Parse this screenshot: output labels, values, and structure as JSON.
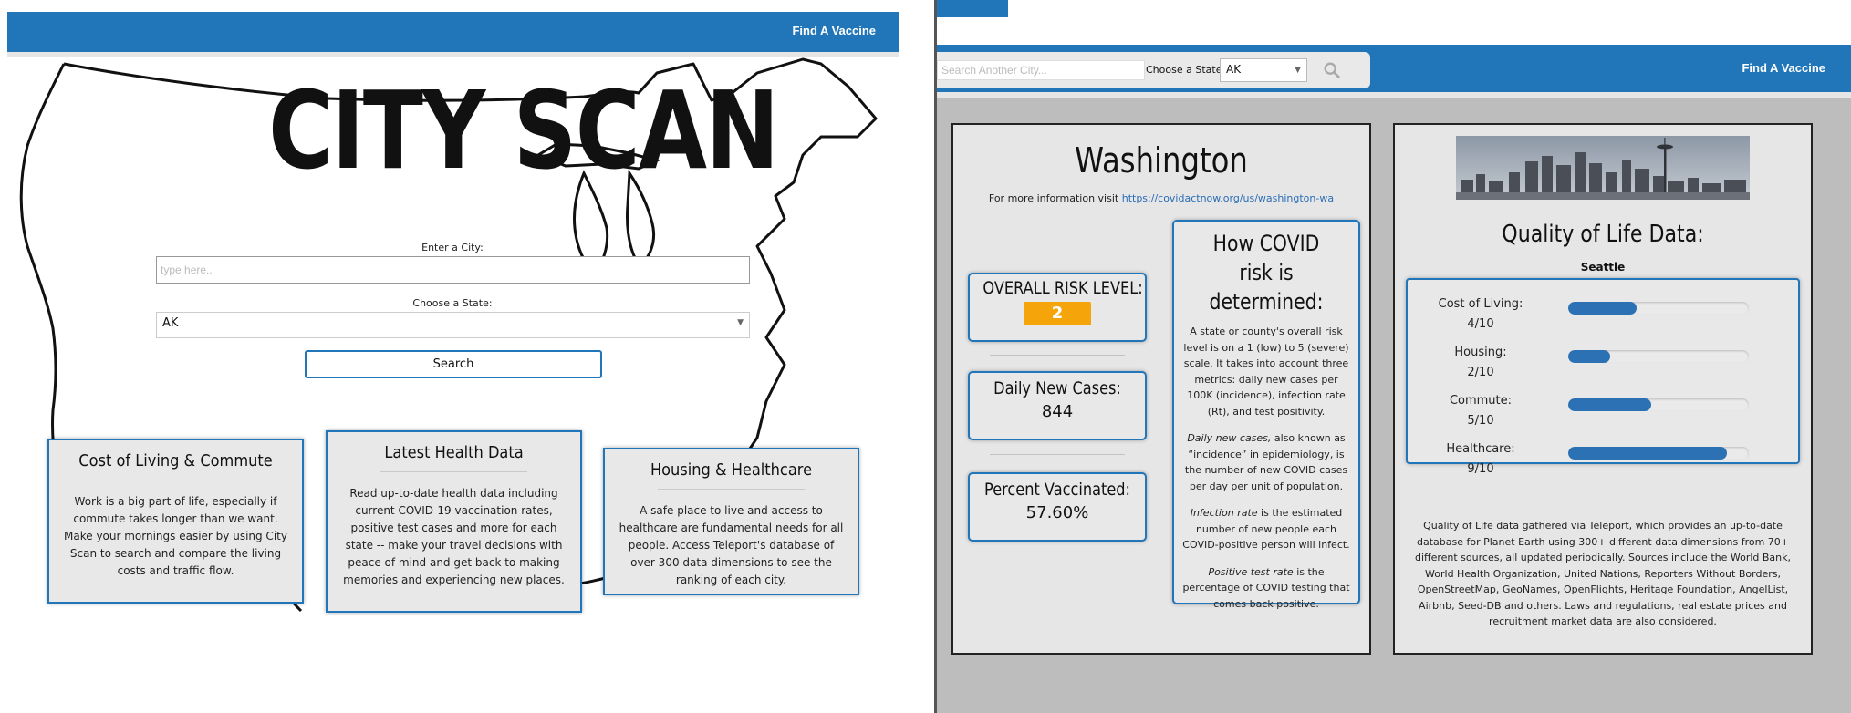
{
  "colors": {
    "brand_blue": "#2176ba",
    "risk_orange": "#f5a40a",
    "link_blue": "#2a6db6"
  },
  "landing": {
    "nav": {
      "find_vaccine": "Find A Vaccine"
    },
    "hero_title": "CITY SCAN",
    "city_label": "Enter a City:",
    "city_placeholder": "type here..",
    "state_label": "Choose a State:",
    "state_value": "AK",
    "search_button": "Search",
    "cards": [
      {
        "title": "Cost of Living & Commute",
        "body": "Work is a big part of life, especially if commute takes longer than we want. Make your mornings easier by using City Scan to search and compare the living costs and traffic flow."
      },
      {
        "title": "Latest Health Data",
        "body": "Read up-to-date health data including current COVID-19 vaccination rates, positive test cases and more for each state -- make your travel decisions with peace of mind and get back to making memories and experiencing new places."
      },
      {
        "title": "Housing & Healthcare",
        "body": "A safe place to live and access to healthcare are fundamental needs for all people. Access Teleport's database of over 300 data dimensions to see the ranking of each city."
      }
    ]
  },
  "results": {
    "nav": {
      "city_placeholder": "Search Another City...",
      "state_label": "Choose a State:",
      "state_value": "AK",
      "find_vaccine": "Find A Vaccine"
    },
    "state_name": "Washington",
    "more_info_prefix": "For more information visit",
    "more_info_link": "https://covidactnow.org/us/washington-wa",
    "risk": {
      "title": "OVERALL RISK LEVEL:",
      "value": "2"
    },
    "daily_cases": {
      "title": "Daily New Cases:",
      "value": "844"
    },
    "vaccinated": {
      "title": "Percent Vaccinated:",
      "value": "57.60%"
    },
    "covid_info": {
      "title": "How COVID risk is determined:",
      "p1": "A state or county's overall risk level is on a 1 (low) to 5 (severe) scale. It takes into account three metrics: daily new cases per 100K (incidence), infection rate (Rt), and test positivity.",
      "p2_em": "Daily new cases,",
      "p2": " also known as “incidence” in epidemiology, is the number of new COVID cases per day per unit of population.",
      "p3_em": "Infection rate",
      "p3": " is the estimated number of new people each COVID-positive person will infect.",
      "p4_em": "Positive test rate",
      "p4": " is the percentage of COVID testing that comes back positive."
    },
    "qol": {
      "title": "Quality of Life Data:",
      "city": "Seattle",
      "rows": [
        {
          "label": "Cost of Living:",
          "score": "4/10",
          "fraction": 0.38
        },
        {
          "label": "Housing:",
          "score": "2/10",
          "fraction": 0.23
        },
        {
          "label": "Commute:",
          "score": "5/10",
          "fraction": 0.46
        },
        {
          "label": "Healthcare:",
          "score": "9/10",
          "fraction": 0.88
        }
      ],
      "description": "Quality of Life data gathered via Teleport, which provides an up-to-date database for Planet Earth using 300+ different data dimensions from 70+ different sources, all updated periodically. Sources include the World Bank, World Health Organization, United Nations, Reporters Without Borders, OpenStreetMap, GeoNames, OpenFlights, Heritage Foundation, AngelList, Airbnb, Seed-DB and others. Laws and regulations, real estate prices and recruitment market data are also considered."
    }
  }
}
